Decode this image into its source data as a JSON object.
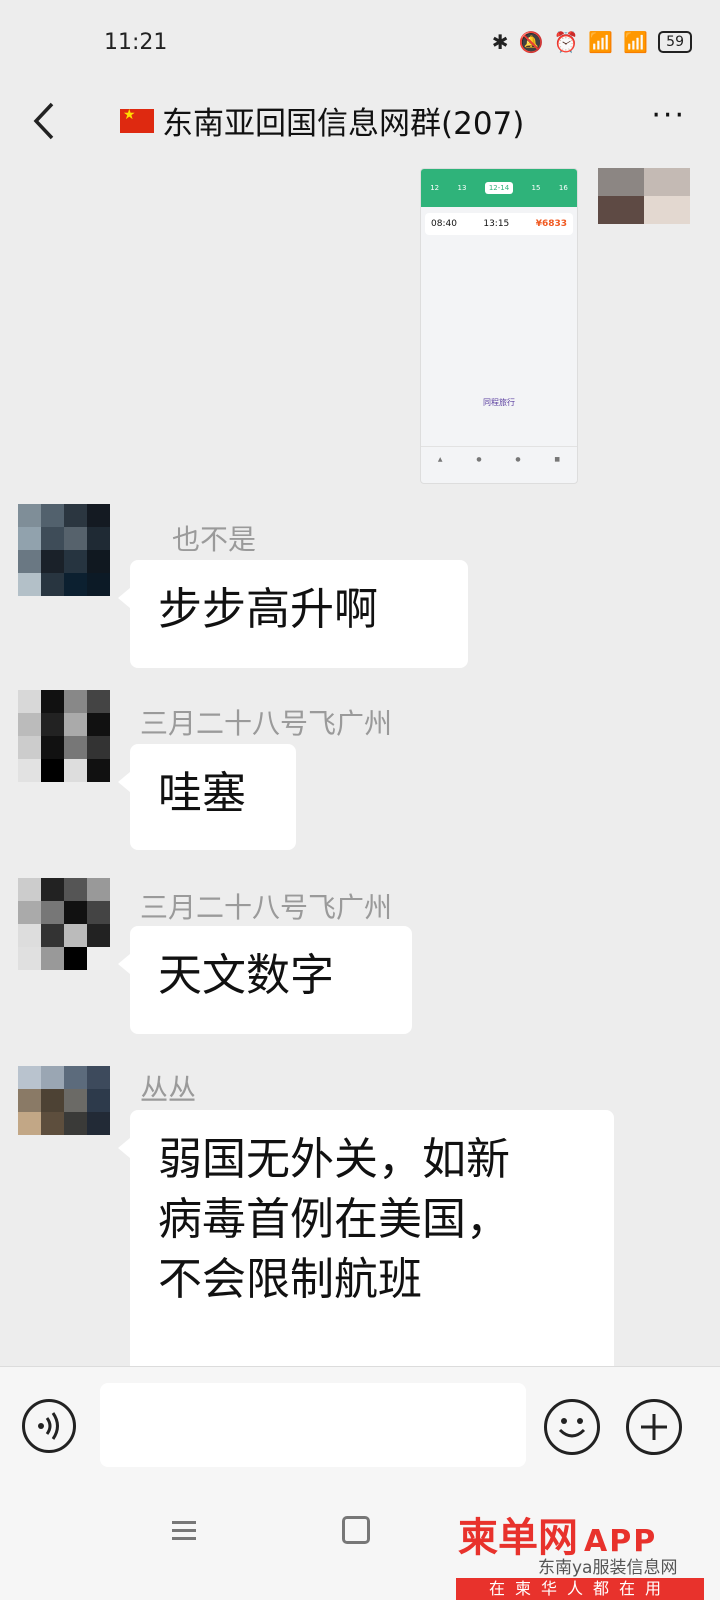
{
  "status_bar": {
    "time": "11:21",
    "icons": [
      "bluetooth-icon",
      "mute-icon",
      "alarm-icon",
      "signal-icon",
      "signal-4g-icon",
      "battery-icon"
    ],
    "battery": "59"
  },
  "header": {
    "title": "东南亚回国信息网群(207)",
    "back_icon": "back-chevron-icon",
    "more_label": "···"
  },
  "messages": [
    {
      "type": "image",
      "description": "flight-booking-screenshot",
      "sender_side": "right",
      "image": {
        "dates": [
          "12",
          "13",
          "12-14",
          "15",
          "16"
        ],
        "depart": "08:40",
        "arrive": "13:15",
        "price": "¥6833",
        "brand": "同程旅行"
      }
    },
    {
      "type": "text",
      "sender": "也不是",
      "text": "步步高升啊"
    },
    {
      "type": "text",
      "sender": "三月二十八号飞广州",
      "text": "哇塞"
    },
    {
      "type": "text",
      "sender": "三月二十八号飞广州",
      "text": "天文数字"
    },
    {
      "type": "text",
      "sender": "丛丛",
      "lines": [
        "弱国无外关，如新",
        "病毒首例在美国，",
        "不会限制航班"
      ]
    }
  ],
  "input_bar": {
    "voice_icon": "voice-icon",
    "emoji_icon": "emoji-icon",
    "plus_icon": "plus-icon"
  },
  "nav_bar": {
    "menu_icon": "menu-icon",
    "home_icon": "home-icon"
  },
  "watermark": {
    "logo": "柬单网",
    "app": "APP",
    "source": "东南ya服装信息网",
    "slogan": "在柬华人都在用"
  },
  "colors": {
    "background": "#ededed",
    "bubble": "#ffffff",
    "accent_green": "#2fb37a",
    "watermark_red": "#e8322c"
  }
}
